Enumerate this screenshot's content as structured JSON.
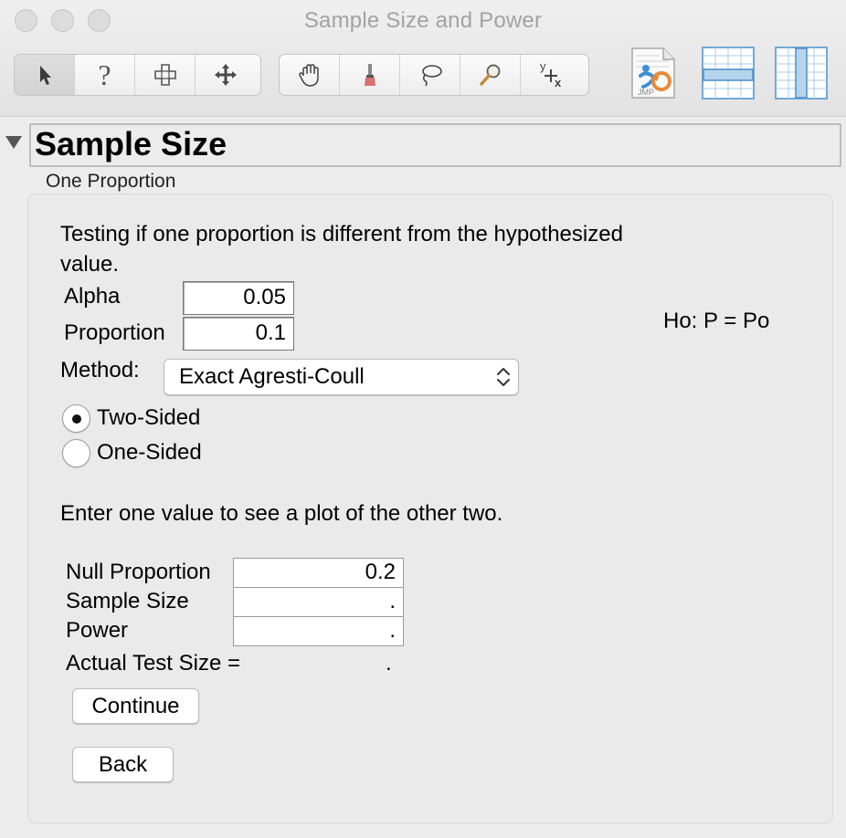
{
  "window": {
    "title": "Sample Size and Power"
  },
  "toolbar": {
    "tools_a": [
      {
        "name": "arrow-tool-icon"
      },
      {
        "name": "help-tool-icon",
        "glyph": "?"
      },
      {
        "name": "selection-tool-icon"
      },
      {
        "name": "scroller-tool-icon"
      }
    ],
    "tools_b": [
      {
        "name": "grabber-tool-icon"
      },
      {
        "name": "brush-tool-icon"
      },
      {
        "name": "lasso-tool-icon"
      },
      {
        "name": "magnifier-tool-icon"
      },
      {
        "name": "crosshair-tool-icon",
        "glyph_y": "y",
        "glyph_x": "x"
      }
    ],
    "jmp_label": "JMP"
  },
  "outline": {
    "title": "Sample Size"
  },
  "subtitle": "One Proportion",
  "form": {
    "description_line1": "Testing if one proportion is different from the hypothesized",
    "description_line2": "value.",
    "alpha_label": "Alpha",
    "alpha_value": "0.05",
    "proportion_label": "Proportion",
    "proportion_value": "0.1",
    "hypothesis": "Ho: P = Po",
    "method_label": "Method:",
    "method_value": "Exact Agresti-Coull",
    "radio_two_sided": "Two-Sided",
    "radio_one_sided": "One-Sided",
    "instruction": "Enter one value to see a plot of the other two.",
    "null_proportion_label": "Null Proportion",
    "null_proportion_value": "0.2",
    "sample_size_label": "Sample Size",
    "sample_size_value": ".",
    "power_label": "Power",
    "power_value": ".",
    "actual_test_size_label": "Actual Test Size =",
    "actual_test_size_value": ".",
    "continue_label": "Continue",
    "back_label": "Back"
  },
  "colors": {
    "accent_blue": "#3f8fd4",
    "accent_orange": "#e88a3a"
  }
}
